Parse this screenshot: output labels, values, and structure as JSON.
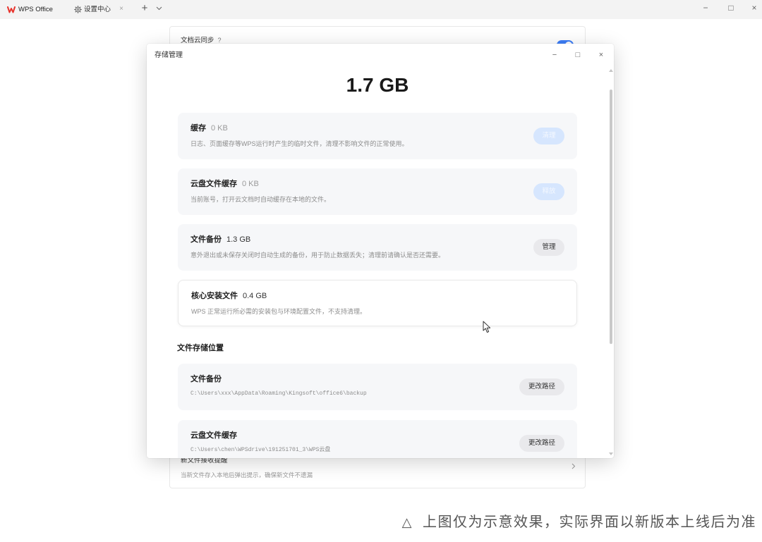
{
  "titlebar": {
    "app_icon": "wps-logo-icon",
    "app_name": "WPS Office",
    "tab_icon": "gear-icon",
    "tab_label": "设置中心",
    "tab_close": "×",
    "new_tab": "+",
    "tab_list_icon": "chevron-down-icon",
    "window_minimize": "−",
    "window_maximize": "□",
    "window_close": "×"
  },
  "settings_page": {
    "cloud_sync_title": "文档云同步",
    "cloud_sync_help": "?",
    "new_file_notify_title": "新文件接收提醒",
    "new_file_notify_desc": "当新文件存入本地后弹出提示，确保新文件不遗漏",
    "new_file_notify_icon": "chevron-right-icon"
  },
  "dialog": {
    "title": "存储管理",
    "minimize": "−",
    "maximize": "□",
    "close": "×",
    "total_size": "1.7 GB",
    "storage_items": [
      {
        "name": "缓存",
        "size": "0 KB",
        "desc": "日志、页面缓存等WPS运行时产生的临时文件，清理不影响文件的正常使用。",
        "action": "清理"
      },
      {
        "name": "云盘文件缓存",
        "size": "0 KB",
        "desc": "当前账号，打开云文档时自动缓存在本地的文件。",
        "action": "释放"
      },
      {
        "name": "文件备份",
        "size": "1.3 GB",
        "desc": "意外退出或未保存关闭时自动生成的备份，用于防止数据丢失；清理前请确认是否还需要。",
        "action": "管理"
      },
      {
        "name": "核心安装文件",
        "size": "0.4 GB",
        "desc": "WPS 正常运行所必需的安装包与环境配置文件，不支持清理。"
      }
    ],
    "location_section_title": "文件存储位置",
    "locations": [
      {
        "name": "文件备份",
        "path": "C:\\Users\\xxx\\AppData\\Roaming\\Kingsoft\\office6\\backup",
        "action": "更改路径"
      },
      {
        "name": "云盘文件缓存",
        "path": "C:\\Users\\chen\\WPSdrive\\191251701_3\\WPS云盘",
        "action": "更改路径"
      }
    ]
  },
  "caption": {
    "icon": "△",
    "text": "上图仅为示意效果，实际界面以新版本上线后为准"
  },
  "colors": {
    "brand": "#e8342d",
    "accent": "#3d7ef8",
    "disabled_button": "#d6e6fe",
    "secondary_button": "#e9e9ec",
    "card_background": "#f6f7f9"
  }
}
